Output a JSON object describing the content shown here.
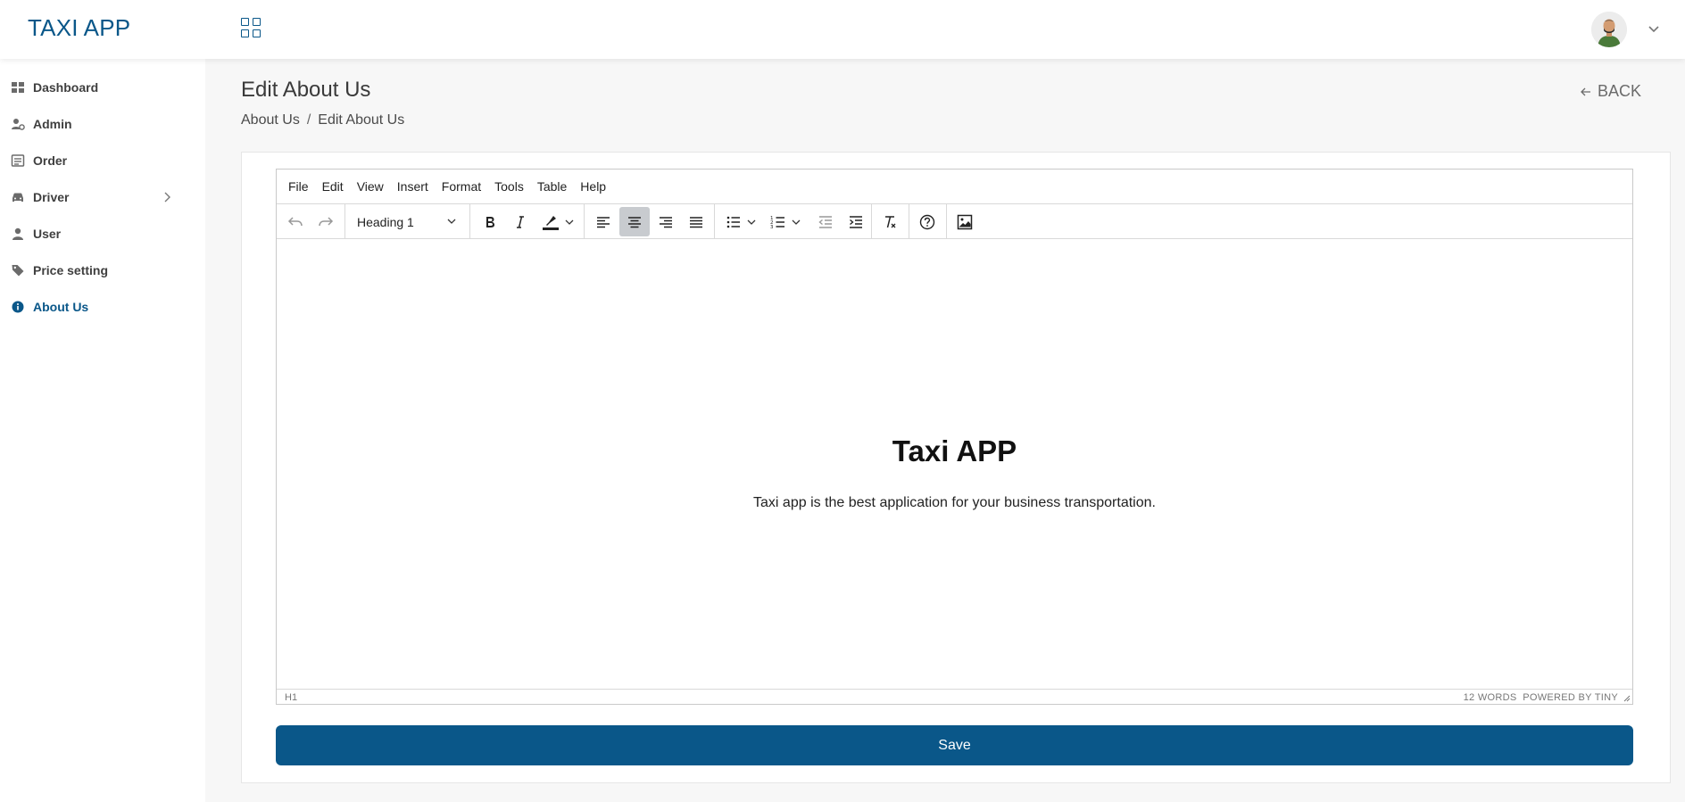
{
  "header": {
    "brand": "TAXI APP",
    "apps_icon": "grid-icon",
    "avatar_icon": "user-avatar",
    "caret_icon": "chevron-down-icon"
  },
  "sidebar": {
    "items": [
      {
        "label": "Dashboard",
        "icon": "dashboard-icon"
      },
      {
        "label": "Admin",
        "icon": "admin-gear-icon"
      },
      {
        "label": "Order",
        "icon": "order-list-icon"
      },
      {
        "label": "Driver",
        "icon": "car-icon",
        "has_submenu": true
      },
      {
        "label": "User",
        "icon": "user-icon"
      },
      {
        "label": "Price setting",
        "icon": "tag-icon"
      },
      {
        "label": "About Us",
        "icon": "info-icon",
        "active": true
      }
    ]
  },
  "page": {
    "title": "Edit About Us",
    "back_label": "BACK",
    "breadcrumb": [
      "About Us",
      "Edit About Us"
    ]
  },
  "editor": {
    "menu": [
      "File",
      "Edit",
      "View",
      "Insert",
      "Format",
      "Tools",
      "Table",
      "Help"
    ],
    "block_format": "Heading 1",
    "content_heading": "Taxi APP",
    "content_paragraph": "Taxi app is the best application for your business transportation.",
    "status_path": "H1",
    "word_count": "12 WORDS",
    "powered_by": "POWERED BY TINY"
  },
  "actions": {
    "save_label": "Save"
  },
  "colors": {
    "brand": "#0a5789",
    "sidebar_bg": "#ffffff",
    "page_bg": "#f7f7f7",
    "active_toolbar": "#c8cbcf"
  }
}
